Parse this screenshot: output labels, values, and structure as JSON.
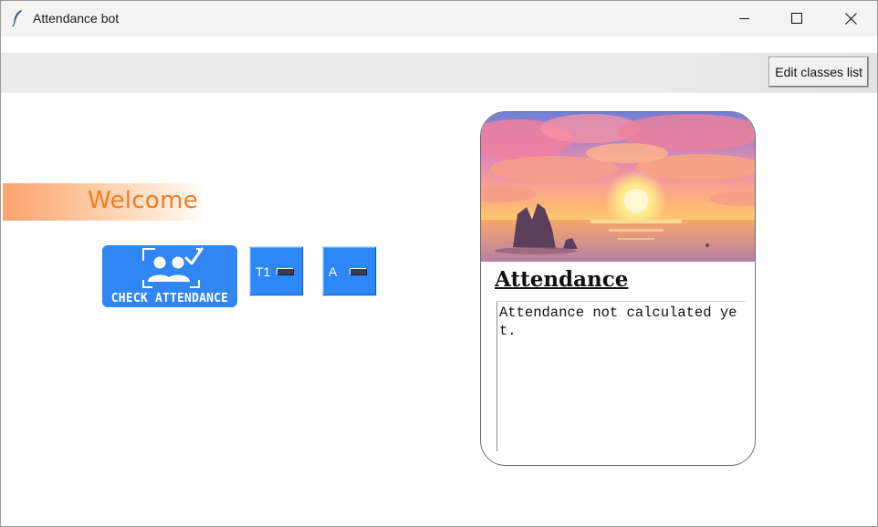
{
  "window": {
    "title": "Attendance bot",
    "app_icon": "feather-icon",
    "controls": {
      "minimize": "minimize-icon",
      "maximize": "maximize-icon",
      "close": "close-icon"
    }
  },
  "toolbar": {
    "edit_classes_label": "Edit classes list"
  },
  "main": {
    "welcome_text": "Welcome",
    "check_attendance_label": "CHECK ATTENDANCE",
    "check_attendance_icon": "users-check-icon",
    "option_menus": [
      {
        "value": "T1"
      },
      {
        "value": "A"
      }
    ]
  },
  "card": {
    "image": "sunset-sea-image",
    "title": "Attendance",
    "output_text": "Attendance not calculated yet."
  },
  "colors": {
    "accent_blue": "#2f86f4",
    "welcome_orange": "#f47c20",
    "toolbar_gray": "#ebebeb"
  }
}
